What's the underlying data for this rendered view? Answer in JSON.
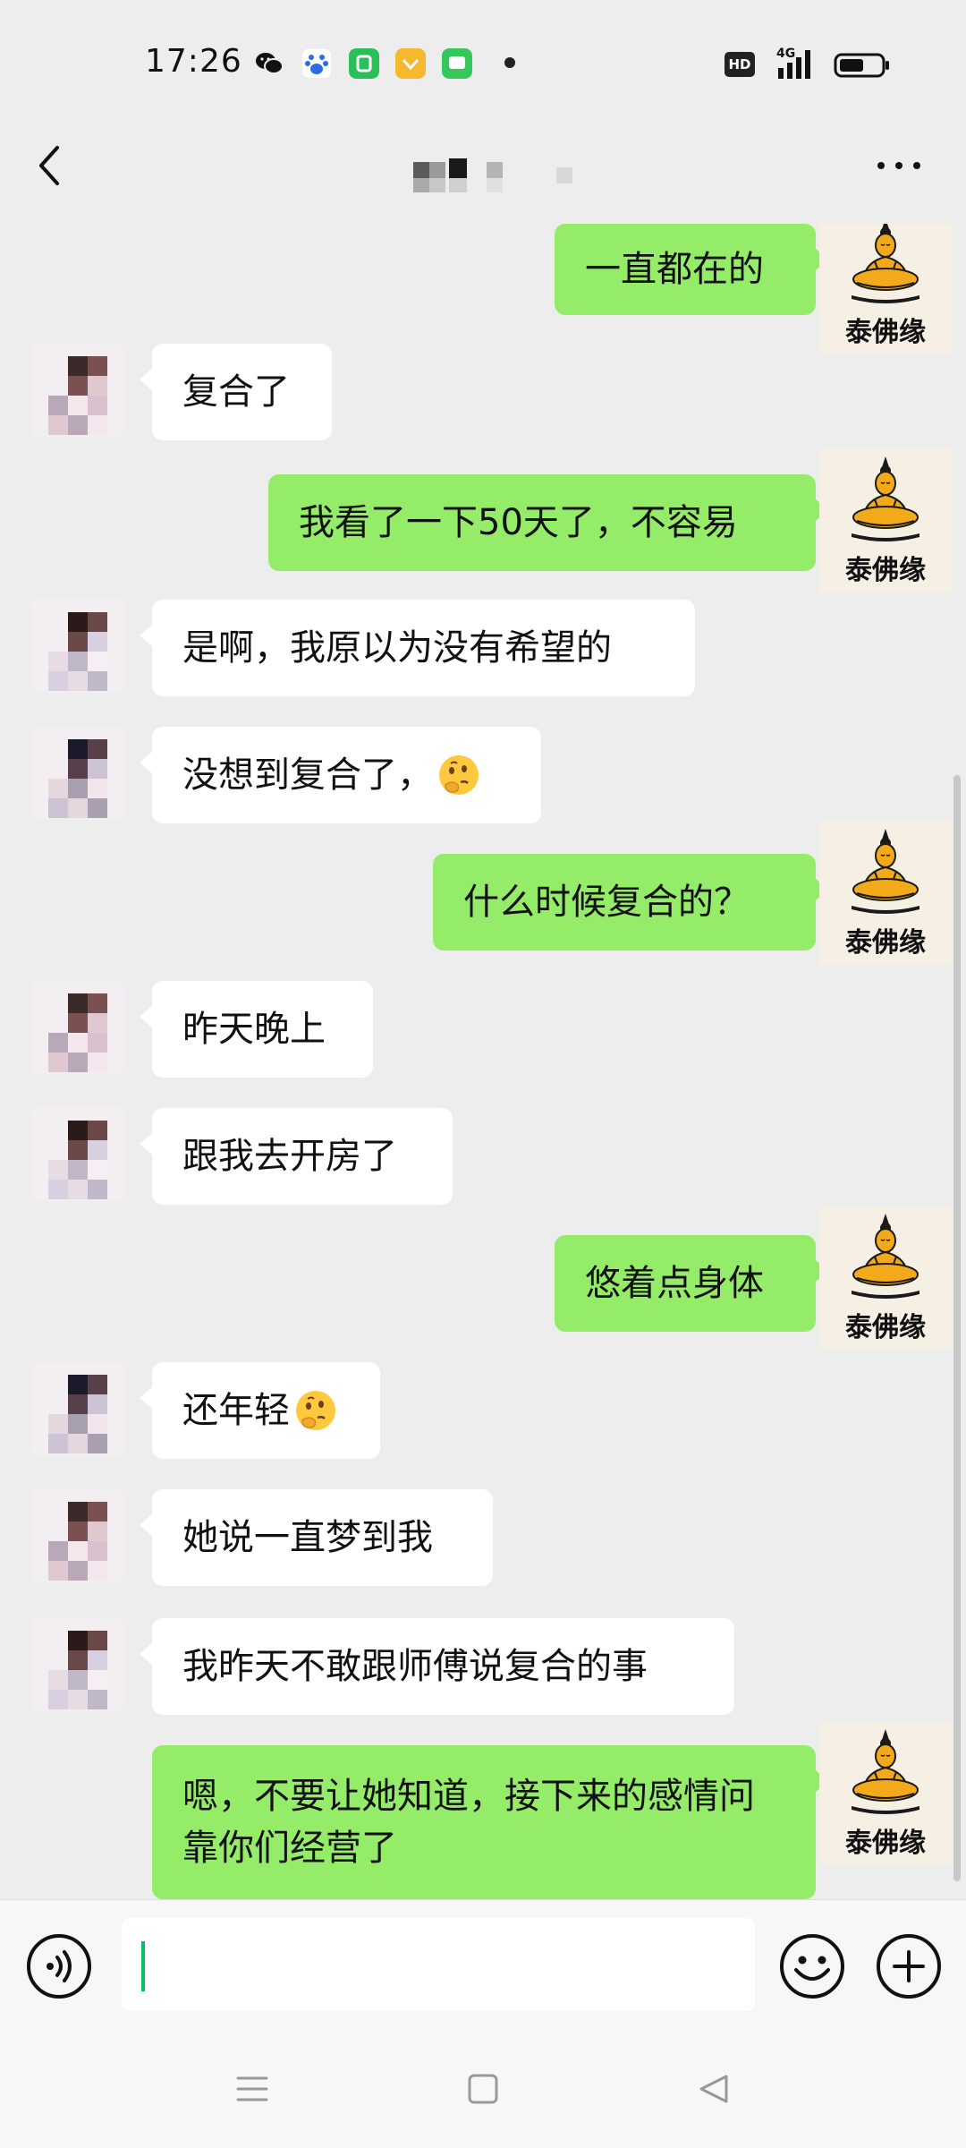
{
  "status_bar": {
    "time": "17:26",
    "hd": "HD",
    "network": "4G",
    "app_icons": [
      "wechat-icon",
      "baidu-icon",
      "app-green-icon",
      "app-yellow-icon",
      "messages-icon"
    ]
  },
  "header": {
    "back_icon": "chevron-left-icon",
    "title_mosaic": "pixelated-contact-name",
    "more_icon": "more-horizontal-icon"
  },
  "sent_avatar_label": "泰佛缘",
  "messages": [
    {
      "side": "sent",
      "text": "一直都在的"
    },
    {
      "side": "recv",
      "text": "复合了"
    },
    {
      "side": "sent",
      "text": "我看了一下50天了，不容易"
    },
    {
      "side": "recv",
      "text": "是啊，我原以为没有希望的"
    },
    {
      "side": "recv",
      "text": "没想到复合了，",
      "emoji": "thinking-face-emoji"
    },
    {
      "side": "sent",
      "text": "什么时候复合的？"
    },
    {
      "side": "recv",
      "text": "昨天晚上"
    },
    {
      "side": "recv",
      "text": "跟我去开房了"
    },
    {
      "side": "sent",
      "text": "悠着点身体"
    },
    {
      "side": "recv",
      "text": "还年轻",
      "emoji": "thinking-face-emoji"
    },
    {
      "side": "recv",
      "text": "她说一直梦到我"
    },
    {
      "side": "recv",
      "text": "我昨天不敢跟师傅说复合的事"
    },
    {
      "side": "sent",
      "text": "嗯，不要让她知道，接下来的感情问靠你们经营了"
    }
  ],
  "input": {
    "value": "",
    "placeholder": ""
  },
  "colors": {
    "sent_bubble": "#95ec69",
    "recv_bubble": "#ffffff",
    "chat_background": "#ededed",
    "caret": "#07c160"
  }
}
